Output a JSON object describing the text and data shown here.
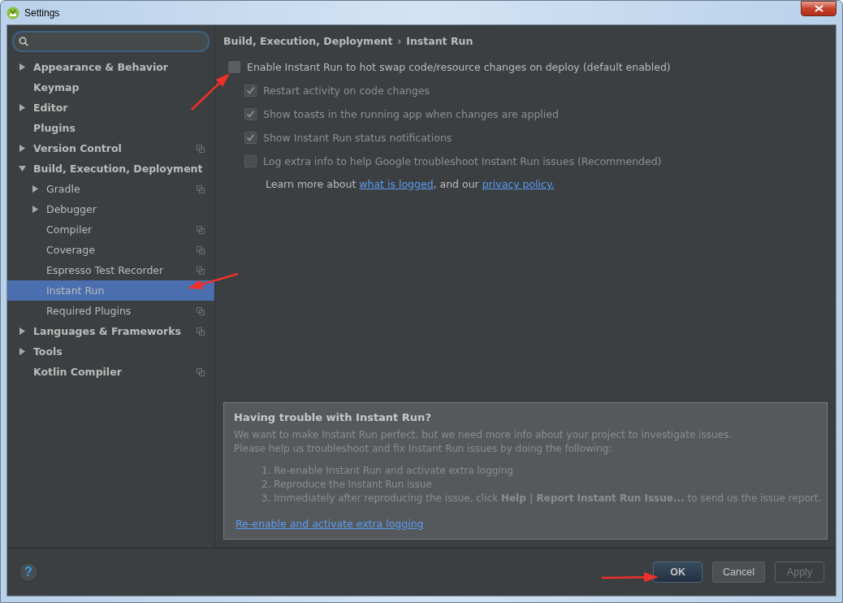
{
  "window": {
    "title": "Settings"
  },
  "sidebar": {
    "items": [
      {
        "label": "Appearance & Behavior",
        "expanded": false,
        "selected": false,
        "project_scope": false
      },
      {
        "label": "Keymap",
        "selected": false,
        "project_scope": false
      },
      {
        "label": "Editor",
        "expanded": false,
        "selected": false,
        "project_scope": false
      },
      {
        "label": "Plugins",
        "selected": false,
        "project_scope": false
      },
      {
        "label": "Version Control",
        "expanded": false,
        "selected": false,
        "project_scope": true
      },
      {
        "label": "Build, Execution, Deployment",
        "expanded": true,
        "selected": false,
        "project_scope": false,
        "children": [
          {
            "label": "Gradle",
            "expanded": false,
            "selected": false,
            "project_scope": true
          },
          {
            "label": "Debugger",
            "expanded": false,
            "selected": false,
            "project_scope": false
          },
          {
            "label": "Compiler",
            "selected": false,
            "project_scope": true
          },
          {
            "label": "Coverage",
            "selected": false,
            "project_scope": true
          },
          {
            "label": "Espresso Test Recorder",
            "selected": false,
            "project_scope": true
          },
          {
            "label": "Instant Run",
            "selected": true,
            "project_scope": false
          },
          {
            "label": "Required Plugins",
            "selected": false,
            "project_scope": true
          }
        ]
      },
      {
        "label": "Languages & Frameworks",
        "expanded": false,
        "selected": false,
        "project_scope": true
      },
      {
        "label": "Tools",
        "expanded": false,
        "selected": false,
        "project_scope": false
      },
      {
        "label": "Kotlin Compiler",
        "selected": false,
        "project_scope": true
      }
    ]
  },
  "breadcrumb": {
    "items": [
      "Build, Execution, Deployment",
      "Instant Run"
    ],
    "separator": "›"
  },
  "checkboxes": [
    {
      "label": "Enable Instant Run to hot swap code/resource changes on deploy (default enabled)",
      "checked": false,
      "disabled": false,
      "children": [
        {
          "label": "Restart activity on code changes",
          "checked": true,
          "disabled": true
        },
        {
          "label": "Show toasts in the running app when changes are applied",
          "checked": true,
          "disabled": true
        },
        {
          "label": "Show Instant Run status notifications",
          "checked": true,
          "disabled": true
        },
        {
          "label": "Log extra info to help Google troubleshoot Instant Run issues (Recommended)",
          "checked": false,
          "disabled": true
        }
      ]
    }
  ],
  "learn_more": [
    {
      "kind": "text",
      "text": "Learn more about "
    },
    {
      "kind": "link",
      "text": "what is logged"
    },
    {
      "kind": "text",
      "text": ", and our "
    },
    {
      "kind": "link",
      "text": "privacy policy."
    }
  ],
  "help_box": {
    "title": "Having trouble with Instant Run?",
    "paragraphs": [
      "We want to make Instant Run perfect, but we need more info about your project to investigate issues.",
      "Please help us troubleshoot and fix Instant Run issues by doing the following:"
    ],
    "steps": [
      {
        "number": "1.",
        "text": "Re-enable Instant Run and activate extra logging"
      },
      {
        "number": "2.",
        "text": "Reproduce the Instant Run issue"
      },
      {
        "number": "3.",
        "text": "Immediately after reproducing the issue, click **Help | Report Instant Run Issue...** to send us the issue report."
      }
    ],
    "link": "Re-enable and activate extra logging"
  },
  "help_button": {
    "label": "?"
  },
  "buttons": [
    {
      "label": "OK",
      "default": true,
      "disabled": false
    },
    {
      "label": "Cancel",
      "default": false,
      "disabled": false
    },
    {
      "label": "Apply",
      "default": false,
      "disabled": true
    }
  ]
}
